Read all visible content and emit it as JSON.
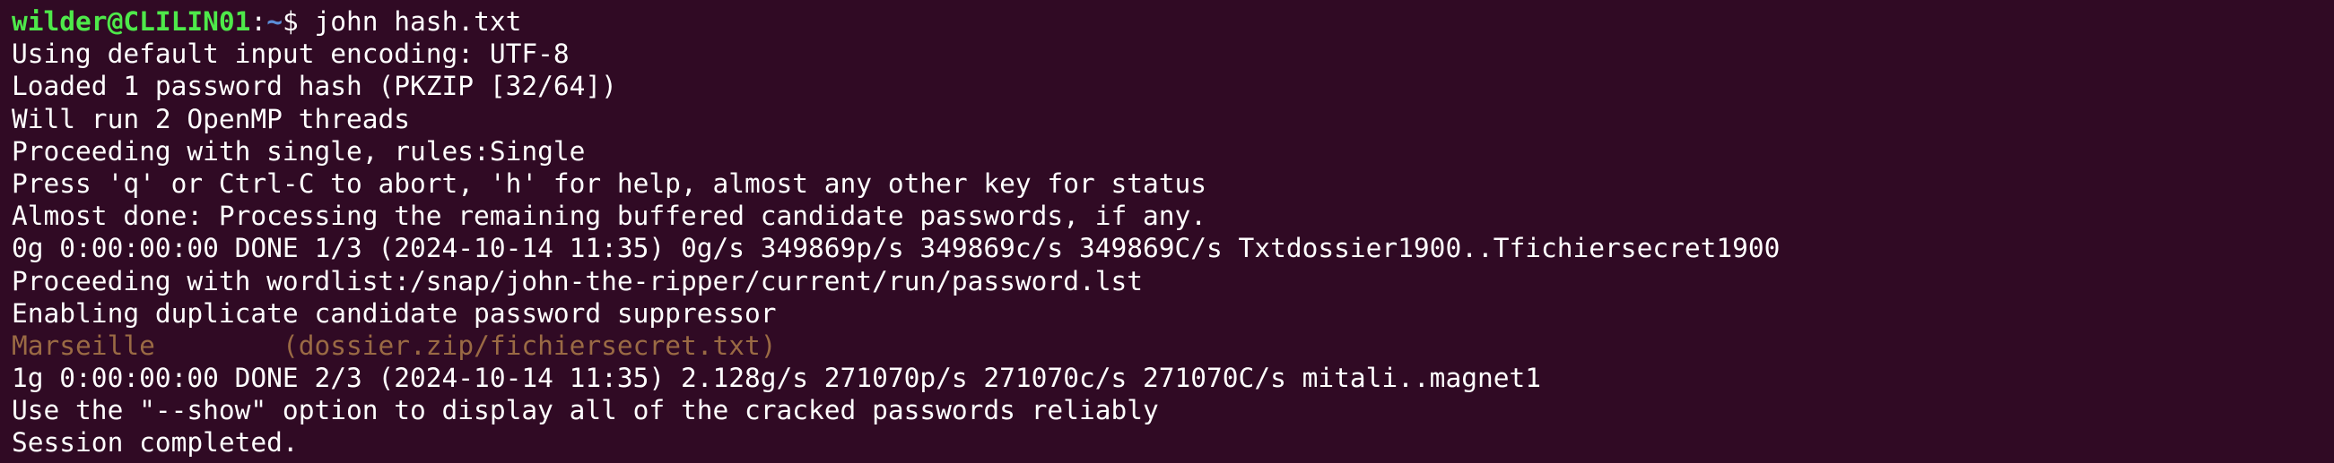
{
  "terminal": {
    "prompt": {
      "user_host": "wilder@CLILIN01",
      "separator": ":",
      "path": "~",
      "symbol": "$ ",
      "command": "john hash.txt"
    },
    "output": [
      "Using default input encoding: UTF-8",
      "Loaded 1 password hash (PKZIP [32/64])",
      "Will run 2 OpenMP threads",
      "Proceeding with single, rules:Single",
      "Press 'q' or Ctrl-C to abort, 'h' for help, almost any other key for status",
      "Almost done: Processing the remaining buffered candidate passwords, if any.",
      "0g 0:00:00:00 DONE 1/3 (2024-10-14 11:35) 0g/s 349869p/s 349869c/s 349869C/s Txtdossier1900..Tfichiersecret1900",
      "Proceeding with wordlist:/snap/john-the-ripper/current/run/password.lst",
      "Enabling duplicate candidate password suppressor"
    ],
    "cracked": {
      "password": "Marseille",
      "gap": "        ",
      "source": "(dossier.zip/fichiersecret.txt)"
    },
    "output_after": [
      "1g 0:00:00:00 DONE 2/3 (2024-10-14 11:35) 2.128g/s 271070p/s 271070c/s 271070C/s mitali..magnet1",
      "Use the \"--show\" option to display all of the cracked passwords reliably",
      "Session completed."
    ]
  },
  "colors": {
    "background": "#300a24",
    "text": "#ffffff",
    "user_host": "#4ee94a",
    "path": "#5b8ed8",
    "cracked": "#9a6a44"
  }
}
